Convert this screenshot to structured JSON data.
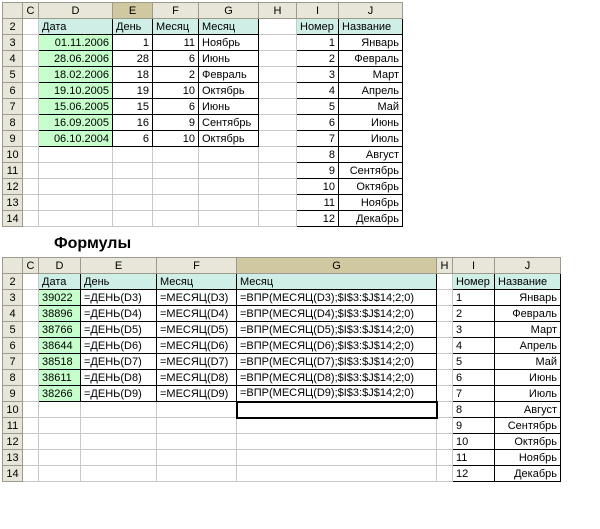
{
  "top": {
    "cols": [
      "",
      "C",
      "D",
      "E",
      "F",
      "G",
      "H",
      "I",
      "J"
    ],
    "rows": [
      "2",
      "3",
      "4",
      "5",
      "6",
      "7",
      "8",
      "9",
      "10",
      "11",
      "12",
      "13",
      "14"
    ],
    "headers": {
      "D": "Дата",
      "E": "День",
      "F": "Месяц",
      "G": "Месяц",
      "I": "Номер",
      "J": "Название"
    },
    "data": [
      {
        "d": "01.11.2006",
        "e": "1",
        "f": "11",
        "g": "Ноябрь",
        "i": "1",
        "j": "Январь"
      },
      {
        "d": "28.06.2006",
        "e": "28",
        "f": "6",
        "g": "Июнь",
        "i": "2",
        "j": "Февраль"
      },
      {
        "d": "18.02.2006",
        "e": "18",
        "f": "2",
        "g": "Февраль",
        "i": "3",
        "j": "Март"
      },
      {
        "d": "19.10.2005",
        "e": "19",
        "f": "10",
        "g": "Октябрь",
        "i": "4",
        "j": "Апрель"
      },
      {
        "d": "15.06.2005",
        "e": "15",
        "f": "6",
        "g": "Июнь",
        "i": "5",
        "j": "Май"
      },
      {
        "d": "16.09.2005",
        "e": "16",
        "f": "9",
        "g": "Сентябрь",
        "i": "6",
        "j": "Июнь"
      },
      {
        "d": "06.10.2004",
        "e": "6",
        "f": "10",
        "g": "Октябрь",
        "i": "7",
        "j": "Июль"
      }
    ],
    "months_rest": [
      {
        "i": "8",
        "j": "Август"
      },
      {
        "i": "9",
        "j": "Сентябрь"
      },
      {
        "i": "10",
        "j": "Октябрь"
      },
      {
        "i": "11",
        "j": "Ноябрь"
      },
      {
        "i": "12",
        "j": "Декабрь"
      }
    ]
  },
  "title": "Формулы",
  "bottom": {
    "cols": [
      "",
      "C",
      "D",
      "E",
      "F",
      "G",
      "H",
      "I",
      "J"
    ],
    "rows": [
      "2",
      "3",
      "4",
      "5",
      "6",
      "7",
      "8",
      "9",
      "10",
      "11",
      "12",
      "13",
      "14"
    ],
    "headers": {
      "D": "Дата",
      "E": "День",
      "F": "Месяц",
      "G": "Месяц",
      "I": "Номер",
      "J": "Название"
    },
    "data": [
      {
        "d": "39022",
        "e": "=ДЕНЬ(D3)",
        "f": "=МЕСЯЦ(D3)",
        "g": "=ВПР(МЕСЯЦ(D3);$I$3:$J$14;2;0)",
        "i": "1",
        "j": "Январь"
      },
      {
        "d": "38896",
        "e": "=ДЕНЬ(D4)",
        "f": "=МЕСЯЦ(D4)",
        "g": "=ВПР(МЕСЯЦ(D4);$I$3:$J$14;2;0)",
        "i": "2",
        "j": "Февраль"
      },
      {
        "d": "38766",
        "e": "=ДЕНЬ(D5)",
        "f": "=МЕСЯЦ(D5)",
        "g": "=ВПР(МЕСЯЦ(D5);$I$3:$J$14;2;0)",
        "i": "3",
        "j": "Март"
      },
      {
        "d": "38644",
        "e": "=ДЕНЬ(D6)",
        "f": "=МЕСЯЦ(D6)",
        "g": "=ВПР(МЕСЯЦ(D6);$I$3:$J$14;2;0)",
        "i": "4",
        "j": "Апрель"
      },
      {
        "d": "38518",
        "e": "=ДЕНЬ(D7)",
        "f": "=МЕСЯЦ(D7)",
        "g": "=ВПР(МЕСЯЦ(D7);$I$3:$J$14;2;0)",
        "i": "5",
        "j": "Май"
      },
      {
        "d": "38611",
        "e": "=ДЕНЬ(D8)",
        "f": "=МЕСЯЦ(D8)",
        "g": "=ВПР(МЕСЯЦ(D8);$I$3:$J$14;2;0)",
        "i": "6",
        "j": "Июнь"
      },
      {
        "d": "38266",
        "e": "=ДЕНЬ(D9)",
        "f": "=МЕСЯЦ(D9)",
        "g": "=ВПР(МЕСЯЦ(D9);$I$3:$J$14;2;0)",
        "i": "7",
        "j": "Июль"
      }
    ],
    "months_rest": [
      {
        "i": "8",
        "j": "Август"
      },
      {
        "i": "9",
        "j": "Сентябрь"
      },
      {
        "i": "10",
        "j": "Октябрь"
      },
      {
        "i": "11",
        "j": "Ноябрь"
      },
      {
        "i": "12",
        "j": "Декабрь"
      }
    ]
  }
}
